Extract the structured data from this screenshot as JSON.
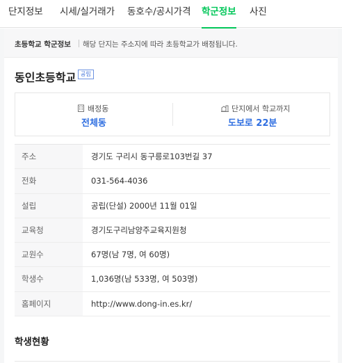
{
  "tabs": [
    {
      "label": "단지정보"
    },
    {
      "label": "시세/실거래가"
    },
    {
      "label": "동호수/공시가격"
    },
    {
      "label": "학군정보"
    },
    {
      "label": "사진"
    }
  ],
  "active_tab": "학군정보",
  "notice": {
    "title": "초등학교 학군정보",
    "text": "해당 단지는 주소지에 따라 초등학교가 배정됩니다."
  },
  "school": {
    "name": "동인초등학교",
    "badge": "공립"
  },
  "summary": {
    "assign_label": "배정동",
    "assign_value": "전체동",
    "assign_icon": "building-icon",
    "distance_label": "단지에서 학교까지",
    "distance_value": "도보로 22분",
    "distance_icon": "walk-icon"
  },
  "info_rows": [
    {
      "label": "주소",
      "value": "경기도 구리시 동구릉로103번길 37"
    },
    {
      "label": "전화",
      "value": "031-564-4036"
    },
    {
      "label": "설립",
      "value": "공립(단설) 2000년 11월 01일"
    },
    {
      "label": "교육청",
      "value": "경기도구리남양주교육지원청"
    },
    {
      "label": "교원수",
      "value": "67명(남 7명, 여 60명)"
    },
    {
      "label": "학생수",
      "value": "1,036명(남 533명, 여 503명)"
    },
    {
      "label": "홈페이지",
      "value": "http://www.dong-in.es.kr/"
    }
  ],
  "section_title": "학생현황",
  "colors": {
    "accent_green": "#03c75a",
    "accent_blue": "#2d6de0"
  }
}
